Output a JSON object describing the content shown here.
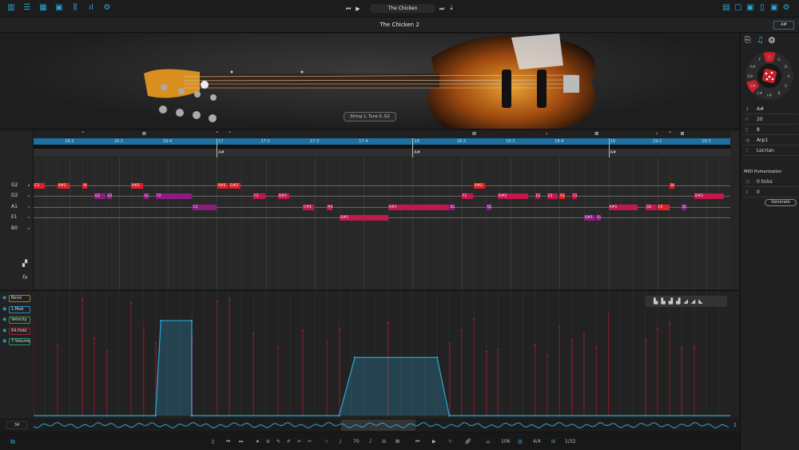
{
  "topbar": {
    "left_icons": [
      "piano-icon",
      "list-icon",
      "grid-icon",
      "device-icon",
      "mixer-icon",
      "spectrum-icon",
      "gear-icon"
    ],
    "song_name": "The Chicken",
    "right_icons": [
      "layout-icon",
      "panel-icon",
      "panel-icon",
      "panel-icon",
      "panel-icon",
      "gear-icon"
    ]
  },
  "titlebar": {
    "title": "The Chicken 2",
    "key_button": "A#"
  },
  "instrument": {
    "tooltip": "String 1, Tune 0, G2"
  },
  "ruler": {
    "labels": [
      {
        "beat": 1,
        "text": "16-2"
      },
      {
        "beat": 2,
        "text": "16-3"
      },
      {
        "beat": 3,
        "text": "16-4"
      },
      {
        "beat": 4,
        "text": "17"
      },
      {
        "beat": 5,
        "text": "17-2"
      },
      {
        "beat": 6,
        "text": "17-3"
      },
      {
        "beat": 7,
        "text": "17-4"
      },
      {
        "beat": 8,
        "text": "18"
      },
      {
        "beat": 9,
        "text": "18-2"
      },
      {
        "beat": 10,
        "text": "18-3"
      },
      {
        "beat": 11,
        "text": "18-4"
      },
      {
        "beat": 12,
        "text": "19"
      },
      {
        "beat": 13,
        "text": "19-2"
      },
      {
        "beat": 14,
        "text": "19-3"
      }
    ]
  },
  "chords": [
    {
      "beat": 4,
      "text": "A#"
    },
    {
      "beat": 8,
      "text": "A#"
    },
    {
      "beat": 12,
      "text": "A#"
    }
  ],
  "strings": [
    {
      "name": "G2",
      "dot": "#c8b020"
    },
    {
      "name": "D2",
      "dot": "#40b040"
    },
    {
      "name": "A1",
      "dot": "#3070d0"
    },
    {
      "name": "E1",
      "dot": "#6060d0"
    },
    {
      "name": "B0",
      "dot": "#888888"
    }
  ],
  "colors": {
    "red": "#e41e26",
    "crimson": "#c2184c",
    "purple": "#8c1c80",
    "accent": "#2aa7d8",
    "ruler": "#1c6fa0"
  },
  "notes": [
    {
      "s": 0,
      "label": "C3",
      "start": 0.26,
      "len": 0.23,
      "c": "red",
      "vel": 95
    },
    {
      "s": 0,
      "label": "A#2",
      "start": 0.75,
      "len": 0.25,
      "c": "red",
      "vel": 72
    },
    {
      "s": 0,
      "label": "A4",
      "start": 1.26,
      "len": 0.1,
      "c": "red",
      "vel": 120
    },
    {
      "s": 0,
      "label": "A#2",
      "start": 2.25,
      "len": 0.25,
      "c": "red",
      "vel": 116
    },
    {
      "s": 0,
      "label": "A#2",
      "start": 4.01,
      "len": 0.23,
      "c": "red",
      "vel": 118
    },
    {
      "s": 0,
      "label": "G#2",
      "start": 4.26,
      "len": 0.22,
      "c": "red",
      "vel": 120
    },
    {
      "s": 0,
      "label": "A#2",
      "start": 9.25,
      "len": 0.23,
      "c": "red",
      "vel": 100
    },
    {
      "s": 0,
      "label": "A#",
      "start": 13.25,
      "len": 0.1,
      "c": "red",
      "vel": 95
    },
    {
      "s": 1,
      "label": "G2",
      "start": 1.5,
      "len": 0.23,
      "c": "purple",
      "vel": 80
    },
    {
      "s": 1,
      "label": "E2",
      "start": 1.76,
      "len": 0.1,
      "c": "purple",
      "vel": 66
    },
    {
      "s": 1,
      "label": "G2",
      "start": 2.51,
      "len": 0.1,
      "c": "purple",
      "vel": 90
    },
    {
      "s": 1,
      "label": "F2",
      "start": 2.76,
      "len": 0.73,
      "c": "purple",
      "vel": 75
    },
    {
      "s": 1,
      "label": "F2",
      "start": 4.75,
      "len": 0.25,
      "c": "crimson",
      "vel": 85
    },
    {
      "s": 1,
      "label": "D#2",
      "start": 5.25,
      "len": 0.23,
      "c": "crimson",
      "vel": 70
    },
    {
      "s": 1,
      "label": "F2",
      "start": 9.0,
      "len": 0.23,
      "c": "crimson",
      "vel": 88
    },
    {
      "s": 1,
      "label": "D#2",
      "start": 9.74,
      "len": 0.62,
      "c": "crimson",
      "vel": 68
    },
    {
      "s": 1,
      "label": "E2",
      "start": 10.5,
      "len": 0.11,
      "c": "crimson",
      "vel": 73
    },
    {
      "s": 1,
      "label": "E2",
      "start": 10.75,
      "len": 0.22,
      "c": "crimson",
      "vel": 62
    },
    {
      "s": 1,
      "label": "F2",
      "start": 11.0,
      "len": 0.11,
      "c": "red",
      "vel": 92
    },
    {
      "s": 1,
      "label": "F2",
      "start": 11.26,
      "len": 0.1,
      "c": "crimson",
      "vel": 78
    },
    {
      "s": 1,
      "label": "D#2",
      "start": 13.75,
      "len": 0.6,
      "c": "crimson",
      "vel": 70
    },
    {
      "s": 2,
      "label": "C2",
      "start": 3.5,
      "len": 0.49,
      "c": "purple",
      "vel": 82
    },
    {
      "s": 2,
      "label": "C#2",
      "start": 5.76,
      "len": 0.23,
      "c": "crimson",
      "vel": 88
    },
    {
      "s": 2,
      "label": "A#",
      "start": 6.25,
      "len": 0.11,
      "c": "crimson",
      "vel": 76
    },
    {
      "s": 2,
      "label": "A#1",
      "start": 7.5,
      "len": 1.24,
      "c": "crimson",
      "vel": 96
    },
    {
      "s": 2,
      "label": "D2",
      "start": 8.76,
      "len": 0.1,
      "c": "purple",
      "vel": 74
    },
    {
      "s": 2,
      "label": "D2",
      "start": 9.51,
      "len": 0.1,
      "c": "purple",
      "vel": 66
    },
    {
      "s": 2,
      "label": "A#1",
      "start": 12.0,
      "len": 0.6,
      "c": "crimson",
      "vel": 105
    },
    {
      "s": 2,
      "label": "D2",
      "start": 12.76,
      "len": 0.23,
      "c": "crimson",
      "vel": 78
    },
    {
      "s": 2,
      "label": "F2",
      "start": 13.0,
      "len": 0.25,
      "c": "red",
      "vel": 90
    },
    {
      "s": 2,
      "label": "D2",
      "start": 13.49,
      "len": 0.1,
      "c": "purple",
      "vel": 70
    },
    {
      "s": 3,
      "label": "G#1",
      "start": 6.51,
      "len": 1.0,
      "c": "crimson",
      "vel": 90
    },
    {
      "s": 3,
      "label": "G#1",
      "start": 11.5,
      "len": 0.23,
      "c": "purple",
      "vel": 84
    },
    {
      "s": 3,
      "label": "G#",
      "start": 11.75,
      "len": 0.1,
      "c": "purple",
      "vel": 70
    }
  ],
  "lanes": [
    {
      "label": "Bend",
      "color": "#a08020"
    },
    {
      "label": "1.Mod",
      "color": "#2a8ad0"
    },
    {
      "label": "Velocity",
      "color": "#3a9a3a"
    },
    {
      "label": "64.Hold",
      "color": "#a02040"
    },
    {
      "label": "7.Volume",
      "color": "#2a9a70"
    }
  ],
  "automation": {
    "lane": "1.Mod",
    "range": [
      0,
      127
    ],
    "points": [
      [
        2.75,
        0
      ],
      [
        2.86,
        98
      ],
      [
        3.49,
        98
      ],
      [
        3.49,
        0
      ],
      [
        6.5,
        0
      ],
      [
        6.82,
        60
      ],
      [
        8.5,
        60
      ],
      [
        8.75,
        0
      ]
    ]
  },
  "overview": {
    "zoom": "34"
  },
  "right_panel": {
    "tabs": [
      "chord-icon",
      "note-icon",
      "gear-icon"
    ],
    "wheel": [
      "C",
      "G",
      "D",
      "A",
      "E",
      "B",
      "F#",
      "C#",
      "G#",
      "D#",
      "A#",
      "F"
    ],
    "wheel_selected": [
      0,
      8
    ],
    "rows": [
      {
        "icon": "key-icon",
        "text": "A#"
      },
      {
        "icon": "bars-icon",
        "text": "20"
      },
      {
        "icon": "grid-icon",
        "text": "8"
      },
      {
        "icon": "arp-icon",
        "text": "Arp1"
      },
      {
        "icon": "scale-icon",
        "text": "Locrian"
      }
    ],
    "humanization_title": "MIDI Humanization",
    "timing": "0 ticks",
    "velocity": "0",
    "generate": "Generate"
  },
  "bottom": {
    "value1": "70",
    "tempo": "106",
    "meter": "4/4",
    "quantize": "1/32"
  }
}
